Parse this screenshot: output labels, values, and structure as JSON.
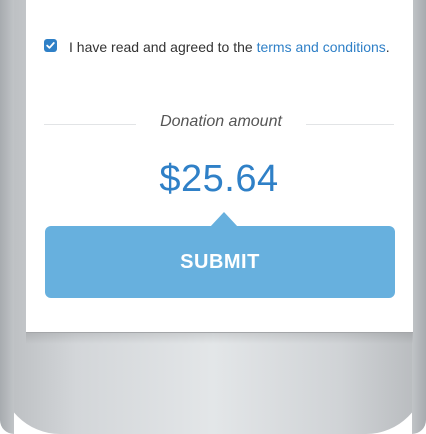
{
  "terms": {
    "checked": true,
    "text_before": "I have read and agreed to the ",
    "link_text": "terms and conditions",
    "text_after": "."
  },
  "donation": {
    "label": "Donation amount",
    "amount": "$25.64"
  },
  "submit": {
    "label": "SUBMIT"
  },
  "colors": {
    "accent": "#2f80c7",
    "button": "#67b0de",
    "bezel": "#d3d6d9"
  }
}
